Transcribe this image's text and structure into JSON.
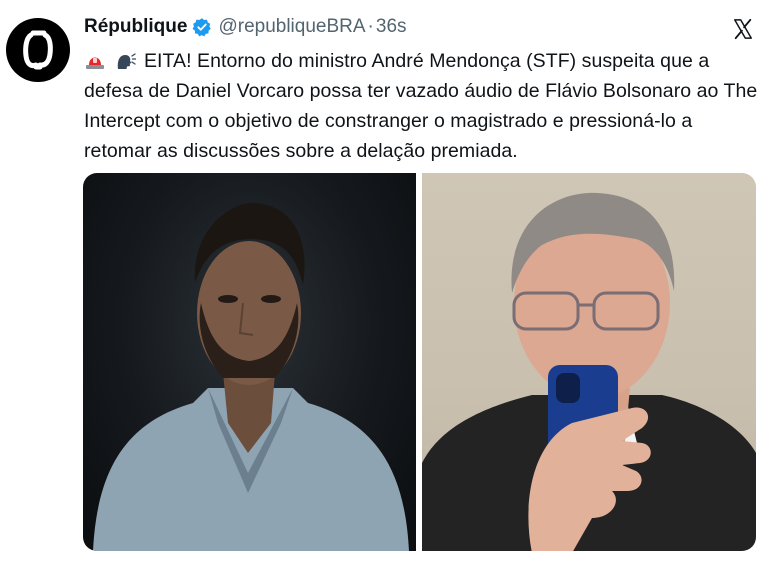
{
  "tweet": {
    "author_name": "République",
    "handle": "@republiqueBRA",
    "separator": "·",
    "timestamp": "36s",
    "text": "EITA! Entorno do ministro André Mendonça (STF) suspeita que a defesa de Daniel Vorcaro possa ter vazado áudio de Flávio Bolsonaro ao The Intercept com o objetivo de constranger o magistrado e pressioná-lo a retomar as discussões sobre a delação premiada."
  },
  "icons": {
    "avatar": "republique-logo-icon",
    "verified": "verified-badge-icon",
    "platform": "x-logo-icon",
    "emoji_1": "police-light-emoji-icon",
    "emoji_2": "speaking-head-emoji-icon"
  },
  "colors": {
    "text": "#0f1419",
    "secondary": "#536471",
    "verified": "#1d9bf0"
  }
}
